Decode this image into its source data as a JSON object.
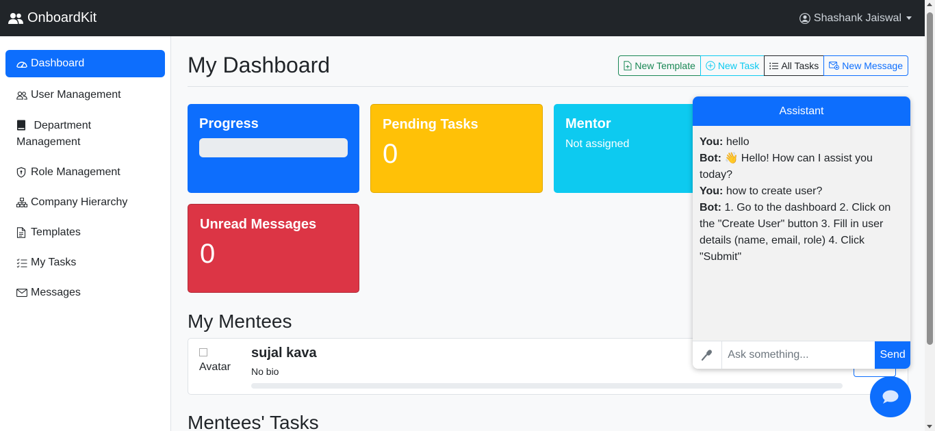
{
  "navbar": {
    "brand": "OnboardKit",
    "brand_icon": "people-icon",
    "user_name": "Shashank Jaiswal",
    "user_icon": "user-circle-icon"
  },
  "sidebar": {
    "items": [
      {
        "label": "Dashboard",
        "icon": "speedometer-icon",
        "active": true
      },
      {
        "label": "User Management",
        "icon": "people-icon"
      },
      {
        "label": "Department Management",
        "icon": "book-icon"
      },
      {
        "label": "Role Management",
        "icon": "shield-icon"
      },
      {
        "label": "Company Hierarchy",
        "icon": "hierarchy-icon"
      },
      {
        "label": "Templates",
        "icon": "document-icon"
      },
      {
        "label": "My Tasks",
        "icon": "list-check-icon"
      },
      {
        "label": "Messages",
        "icon": "envelope-icon"
      }
    ]
  },
  "main": {
    "title": "My Dashboard",
    "buttons": {
      "new_template": "New Template",
      "new_task": "New Task",
      "all_tasks": "All Tasks",
      "new_message": "New Message"
    },
    "cards": {
      "progress": {
        "title": "Progress",
        "value": 0
      },
      "pending": {
        "title": "Pending Tasks",
        "value": "0"
      },
      "mentor": {
        "title": "Mentor",
        "text": "Not assigned"
      },
      "unread": {
        "title": "Unread Messages",
        "value": "0"
      }
    },
    "mentees_title": "My Mentees",
    "mentees": [
      {
        "avatar_alt": "Avatar",
        "name": "sujal kava",
        "bio": "No bio"
      }
    ],
    "mentees_tasks_title": "Mentees' Tasks"
  },
  "chat": {
    "header": "Assistant",
    "messages": [
      {
        "sender": "You:",
        "text": "hello"
      },
      {
        "sender": "Bot:",
        "text": "👋 Hello! How can I assist you today?"
      },
      {
        "sender": "You:",
        "text": "how to create user?"
      },
      {
        "sender": "Bot:",
        "text": "1. Go to the dashboard 2. Click on the \"Create User\" button 3. Fill in user details (name, email, role) 4. Click \"Submit\""
      }
    ],
    "input_placeholder": "Ask something...",
    "send_label": "Send"
  },
  "colors": {
    "primary": "#0d6efd",
    "warning": "#ffc107",
    "info": "#0dcaf0",
    "danger": "#dc3545",
    "success": "#198754",
    "dark": "#212529"
  }
}
